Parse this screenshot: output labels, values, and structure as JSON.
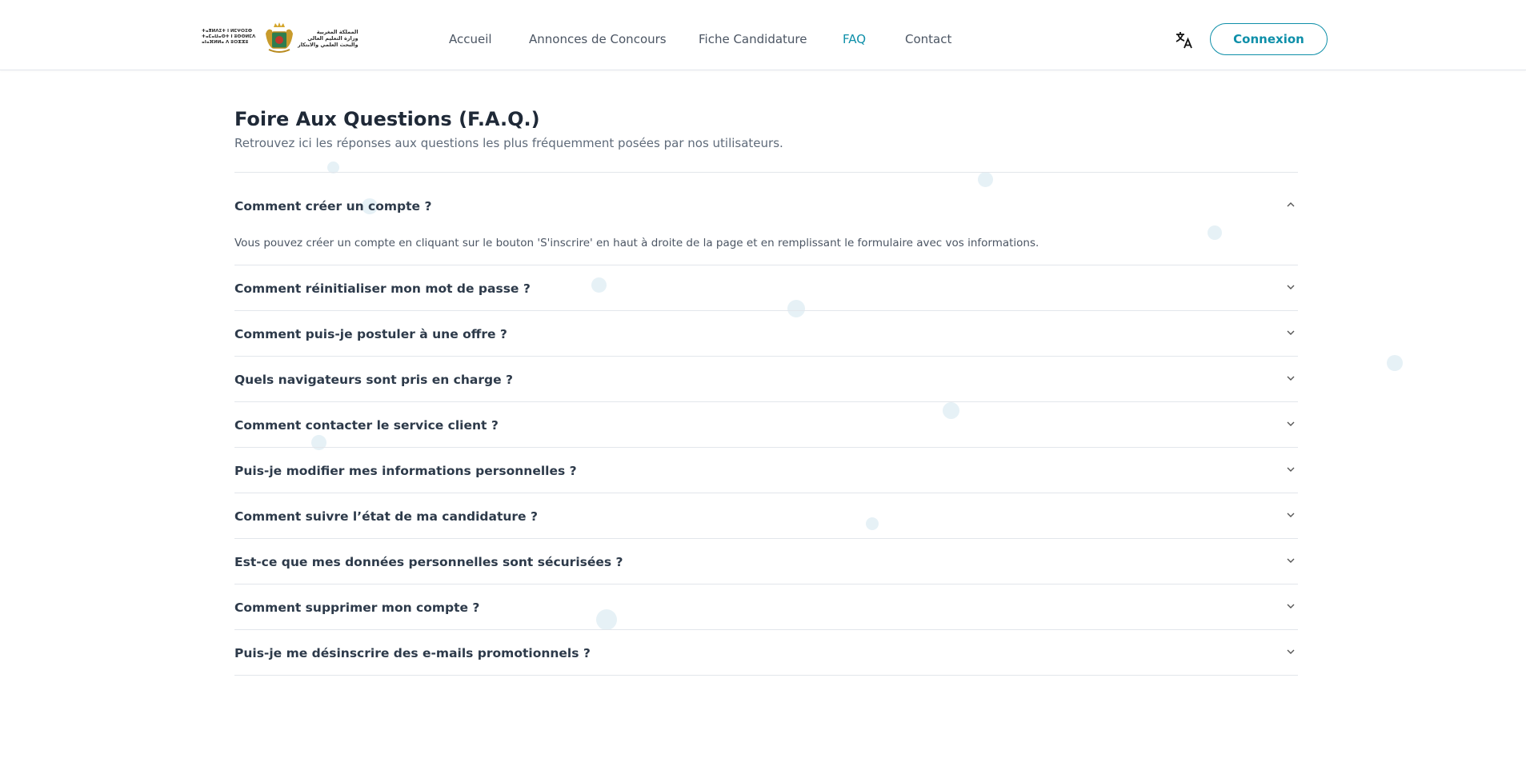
{
  "header": {
    "logo": {
      "line_tifinagh": "ⵜⴰⴳⵍⴷⵉⵜ ⵏ ⵍⵎⵖⵔⵉⴱ",
      "line_fr_1": "ⵜⴰⵎⴰⵡⴰⵙⵜ ⵏ ⵓⵙⵙⵍⵎⴷ",
      "line_fr_2": "ⴰⵏⴰⴼⵍⵍⴰ ⴷ ⵓⵔⵣⵣⵓ",
      "line_ar_1": "المملكة المغربية",
      "line_ar_2": "وزارة التعليم العالي",
      "line_ar_3": "والبحث العلمي والابتكار"
    },
    "nav": [
      {
        "label": "Accueil",
        "active": false
      },
      {
        "label": "Annonces de Concours",
        "active": false
      },
      {
        "label": "Fiche Candidature",
        "active": false
      },
      {
        "label": "FAQ",
        "active": true
      },
      {
        "label": "Contact",
        "active": false
      }
    ],
    "translate_icon": "translate-icon",
    "login_label": "Connexion"
  },
  "page": {
    "title": "Foire Aux Questions (F.A.Q.)",
    "subtitle": "Retrouvez ici les réponses aux questions les plus fréquemment posées par nos utilisateurs."
  },
  "faq": [
    {
      "question": "Comment créer un compte ?",
      "answer": "Vous pouvez créer un compte en cliquant sur le bouton 'S'inscrire' en haut à droite de la page et en remplissant le formulaire avec vos informations.",
      "open": true
    },
    {
      "question": "Comment réinitialiser mon mot de passe ?",
      "open": false
    },
    {
      "question": "Comment puis-je postuler à une offre ?",
      "open": false
    },
    {
      "question": "Quels navigateurs sont pris en charge ?",
      "open": false
    },
    {
      "question": "Comment contacter le service client ?",
      "open": false
    },
    {
      "question": "Puis-je modifier mes informations personnelles ?",
      "open": false
    },
    {
      "question": "Comment suivre l’état de ma candidature ?",
      "open": false
    },
    {
      "question": "Est-ce que mes données personnelles sont sécurisées ?",
      "open": false
    },
    {
      "question": "Comment supprimer mon compte ?",
      "open": false
    },
    {
      "question": "Puis-je me désinscrire des e-mails promotionnels ?",
      "open": false
    }
  ],
  "colors": {
    "accent": "#0e8fa9",
    "text": "#2d3a4a",
    "muted": "#5f6b7a",
    "divider": "#e2e6eb",
    "bubble": "#e6f1f6"
  }
}
